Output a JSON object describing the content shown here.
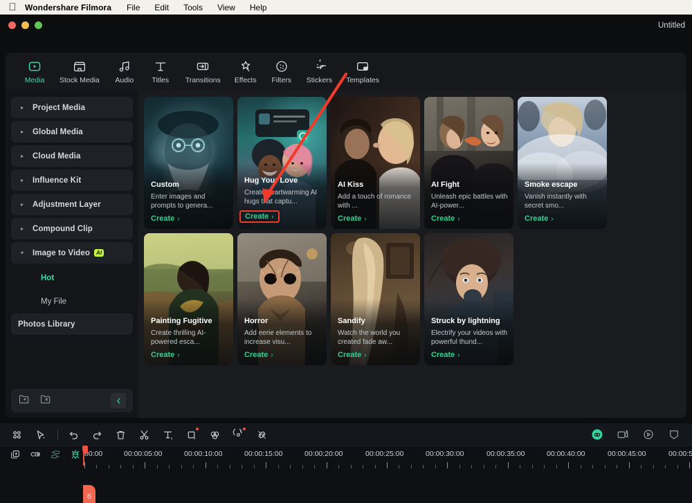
{
  "menubar": {
    "apple_icon": "apple-logo",
    "app_name": "Wondershare Filmora",
    "items": [
      "File",
      "Edit",
      "Tools",
      "View",
      "Help"
    ]
  },
  "titlebar": {
    "document_title": "Untitled"
  },
  "tabs": [
    {
      "label": "Media",
      "icon": "media-icon",
      "active": true
    },
    {
      "label": "Stock Media",
      "icon": "stock-media-icon",
      "active": false
    },
    {
      "label": "Audio",
      "icon": "audio-icon",
      "active": false
    },
    {
      "label": "Titles",
      "icon": "titles-icon",
      "active": false
    },
    {
      "label": "Transitions",
      "icon": "transitions-icon",
      "active": false
    },
    {
      "label": "Effects",
      "icon": "effects-icon",
      "active": false
    },
    {
      "label": "Filters",
      "icon": "filters-icon",
      "active": false
    },
    {
      "label": "Stickers",
      "icon": "stickers-icon",
      "active": false
    },
    {
      "label": "Templates",
      "icon": "templates-icon",
      "active": false
    }
  ],
  "sidebar": {
    "items": [
      {
        "label": "Project Media",
        "expandable": true,
        "expanded": false
      },
      {
        "label": "Global Media",
        "expandable": true,
        "expanded": false
      },
      {
        "label": "Cloud Media",
        "expandable": true,
        "expanded": false
      },
      {
        "label": "Influence Kit",
        "expandable": true,
        "expanded": false
      },
      {
        "label": "Adjustment Layer",
        "expandable": true,
        "expanded": false
      },
      {
        "label": "Compound Clip",
        "expandable": true,
        "expanded": false
      },
      {
        "label": "Image to Video",
        "expandable": true,
        "expanded": true,
        "badge": "AI"
      }
    ],
    "sub_items": [
      {
        "label": "Hot",
        "active": true
      },
      {
        "label": "My File",
        "active": false
      }
    ],
    "photos_library": {
      "label": "Photos Library"
    },
    "footer": {
      "new_folder_icon": "new-folder-icon",
      "delete_folder_icon": "delete-folder-icon",
      "collapse_icon": "chevron-left-icon"
    }
  },
  "cards": [
    {
      "title": "Custom",
      "desc": "Enter images and prompts to genera...",
      "create": "Create",
      "highlight": false,
      "art": "wizard-portrait"
    },
    {
      "title": "Hug Your Love",
      "desc": "Create heartwarming AI hugs that captu...",
      "create": "Create",
      "highlight": true,
      "art": "two-women-hug"
    },
    {
      "title": "AI Kiss",
      "desc": "Add a touch of romance with ...",
      "create": "Create",
      "highlight": false,
      "art": "couple-kiss"
    },
    {
      "title": "AI Fight",
      "desc": "Unleash epic battles with AI-power...",
      "create": "Create",
      "highlight": false,
      "art": "two-women-fight"
    },
    {
      "title": "Smoke escape",
      "desc": "Vanish instantly with secret smo...",
      "create": "Create",
      "highlight": false,
      "art": "smoke-woman"
    },
    {
      "title": "Painting Fugitive",
      "desc": "Create thrilling AI-powered esca...",
      "create": "Create",
      "highlight": false,
      "art": "renaissance-painting"
    },
    {
      "title": "Horror",
      "desc": "Add eerie elements to increase visu...",
      "create": "Create",
      "highlight": false,
      "art": "horror-man"
    },
    {
      "title": "Sandify",
      "desc": "Watch the world you created fade aw...",
      "create": "Create",
      "highlight": false,
      "art": "sand-figure"
    },
    {
      "title": "Struck by lightning",
      "desc": "Electrify your videos with powerful thund...",
      "create": "Create",
      "highlight": false,
      "art": "afro-woman"
    }
  ],
  "timeline": {
    "toolbar_left": [
      {
        "icon": "grid-view-icon"
      },
      {
        "icon": "select-tool-icon"
      },
      {
        "icon": "separator"
      },
      {
        "icon": "undo-icon"
      },
      {
        "icon": "redo-icon"
      },
      {
        "icon": "delete-icon"
      },
      {
        "icon": "split-scissors-icon"
      },
      {
        "icon": "text-tool-icon"
      },
      {
        "icon": "crop-icon"
      },
      {
        "icon": "color-match-icon"
      },
      {
        "icon": "ai-audio-icon"
      },
      {
        "icon": "unlink-icon"
      }
    ],
    "toolbar_right": [
      {
        "icon": "ai-avatar-icon"
      },
      {
        "icon": "snapshot-icon"
      },
      {
        "icon": "render-preview-icon"
      },
      {
        "icon": "marker-icon"
      }
    ],
    "track_icons": [
      {
        "icon": "duplicate-icon"
      },
      {
        "icon": "link-group-icon"
      },
      {
        "icon": "auto-align-icon"
      },
      {
        "icon": "magnet-snap-icon"
      }
    ],
    "ruler_labels": [
      "00:00",
      "00:00:05:00",
      "00:00:10:00",
      "00:00:15:00",
      "00:00:20:00",
      "00:00:25:00",
      "00:00:30:00",
      "00:00:35:00",
      "00:00:40:00",
      "00:00:45:00",
      "00:00:5"
    ],
    "marker_label": "6",
    "playhead_position": "00:00"
  },
  "colors": {
    "accent_green": "#3ddca4",
    "create_green": "#2ed392",
    "annotation_red": "#f03a2c",
    "ai_badge": "#c9f53e",
    "panel_bg": "#191b1f",
    "sidebar_bg": "#131518",
    "playhead": "#f2503f"
  }
}
